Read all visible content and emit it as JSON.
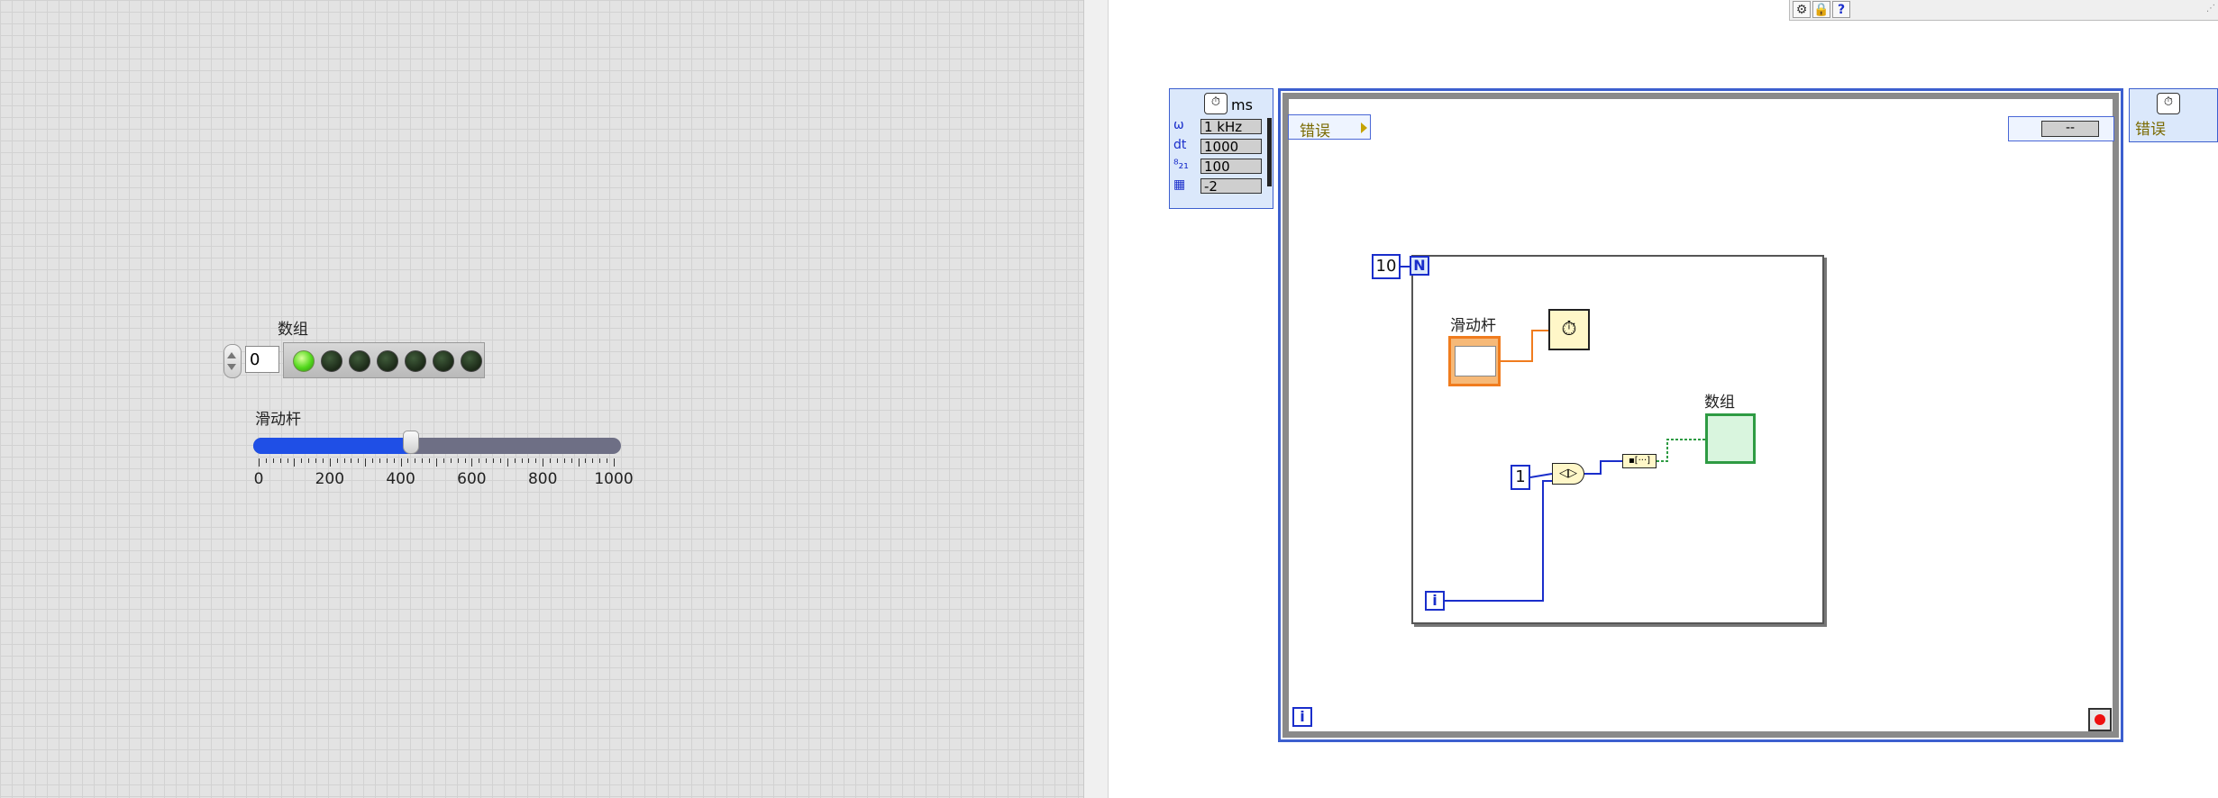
{
  "front_panel": {
    "array_label": "数组",
    "array_index": "0",
    "leds": [
      true,
      false,
      false,
      false,
      false,
      false,
      false
    ],
    "slider": {
      "label": "滑动杆",
      "value": 430,
      "min": 0,
      "max": 1000,
      "tick_labels": [
        "0",
        "200",
        "400",
        "600",
        "800",
        "1000"
      ]
    }
  },
  "block_diagram": {
    "timing_source": {
      "unit": "ms",
      "rows": [
        {
          "label": "ω",
          "value": "1 kHz"
        },
        {
          "label": "dt",
          "value": "1000"
        },
        {
          "label": "⁸₂₁",
          "value": "100"
        },
        {
          "label": "▦",
          "value": "-2"
        }
      ]
    },
    "error_left": "错误",
    "error_right": "错误",
    "right_node_value": "--",
    "for_loop_count": "10",
    "n_terminal": "N",
    "iteration_terminal": "i",
    "timed_loop_iteration_terminal": "i",
    "slider_label": "滑动杆",
    "array_label": "数组",
    "constant_one": "1"
  },
  "toolbar": {
    "icons": [
      "gear-icon",
      "lock-icon",
      "help-icon"
    ],
    "help_label": "?"
  },
  "colors": {
    "numeric_wire": "#1a2ecb",
    "orange_terminal": "#f07c1e",
    "boolean_wire": "#2e9b43",
    "error_text": "#7a6a00"
  }
}
